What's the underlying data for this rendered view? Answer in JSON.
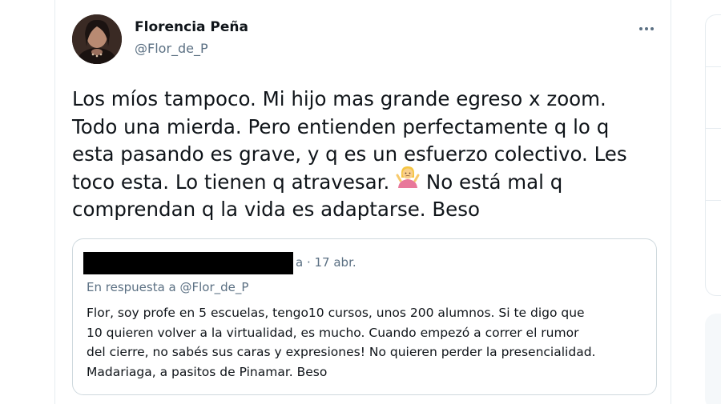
{
  "tweet": {
    "author": {
      "name": "Florencia Peña",
      "handle": "@Flor_de_P"
    },
    "more_icon": "more-horizontal-icon",
    "text_lines": [
      "Los míos tampoco. Mi hijo mas grande egreso x zoom.",
      "Todo una mierda. Pero entienden perfectamente q lo q",
      "esta pasando es grave, y q es un esfuerzo colectivo. Les",
      "toco esta. Lo tienen q atravesar.",
      "comprendan q la vida es adaptarse. Beso"
    ],
    "text_line4_after_emoji": "No está mal q",
    "emoji": "person-shrugging-emoji"
  },
  "quoted_tweet": {
    "meta": "a · 17 abr.",
    "reply_prefix": "En respuesta a ",
    "reply_handle": "@Flor_de_P",
    "text_lines": [
      "Flor, soy profe en 5 escuelas, tengo10 cursos, unos 200 alumnos. Si te digo que",
      "10 quieren volver a la virtualidad, es mucho. Cuando empezó a correr el rumor",
      "del cierre, no sabés sus caras y expresiones! No quieren perder la presencialidad.",
      "Madariaga, a pasitos de Pinamar. Beso"
    ]
  },
  "colors": {
    "text": "#0f1419",
    "secondary": "#5b7083",
    "border": "#cfd9de",
    "redaction": "#000000"
  }
}
